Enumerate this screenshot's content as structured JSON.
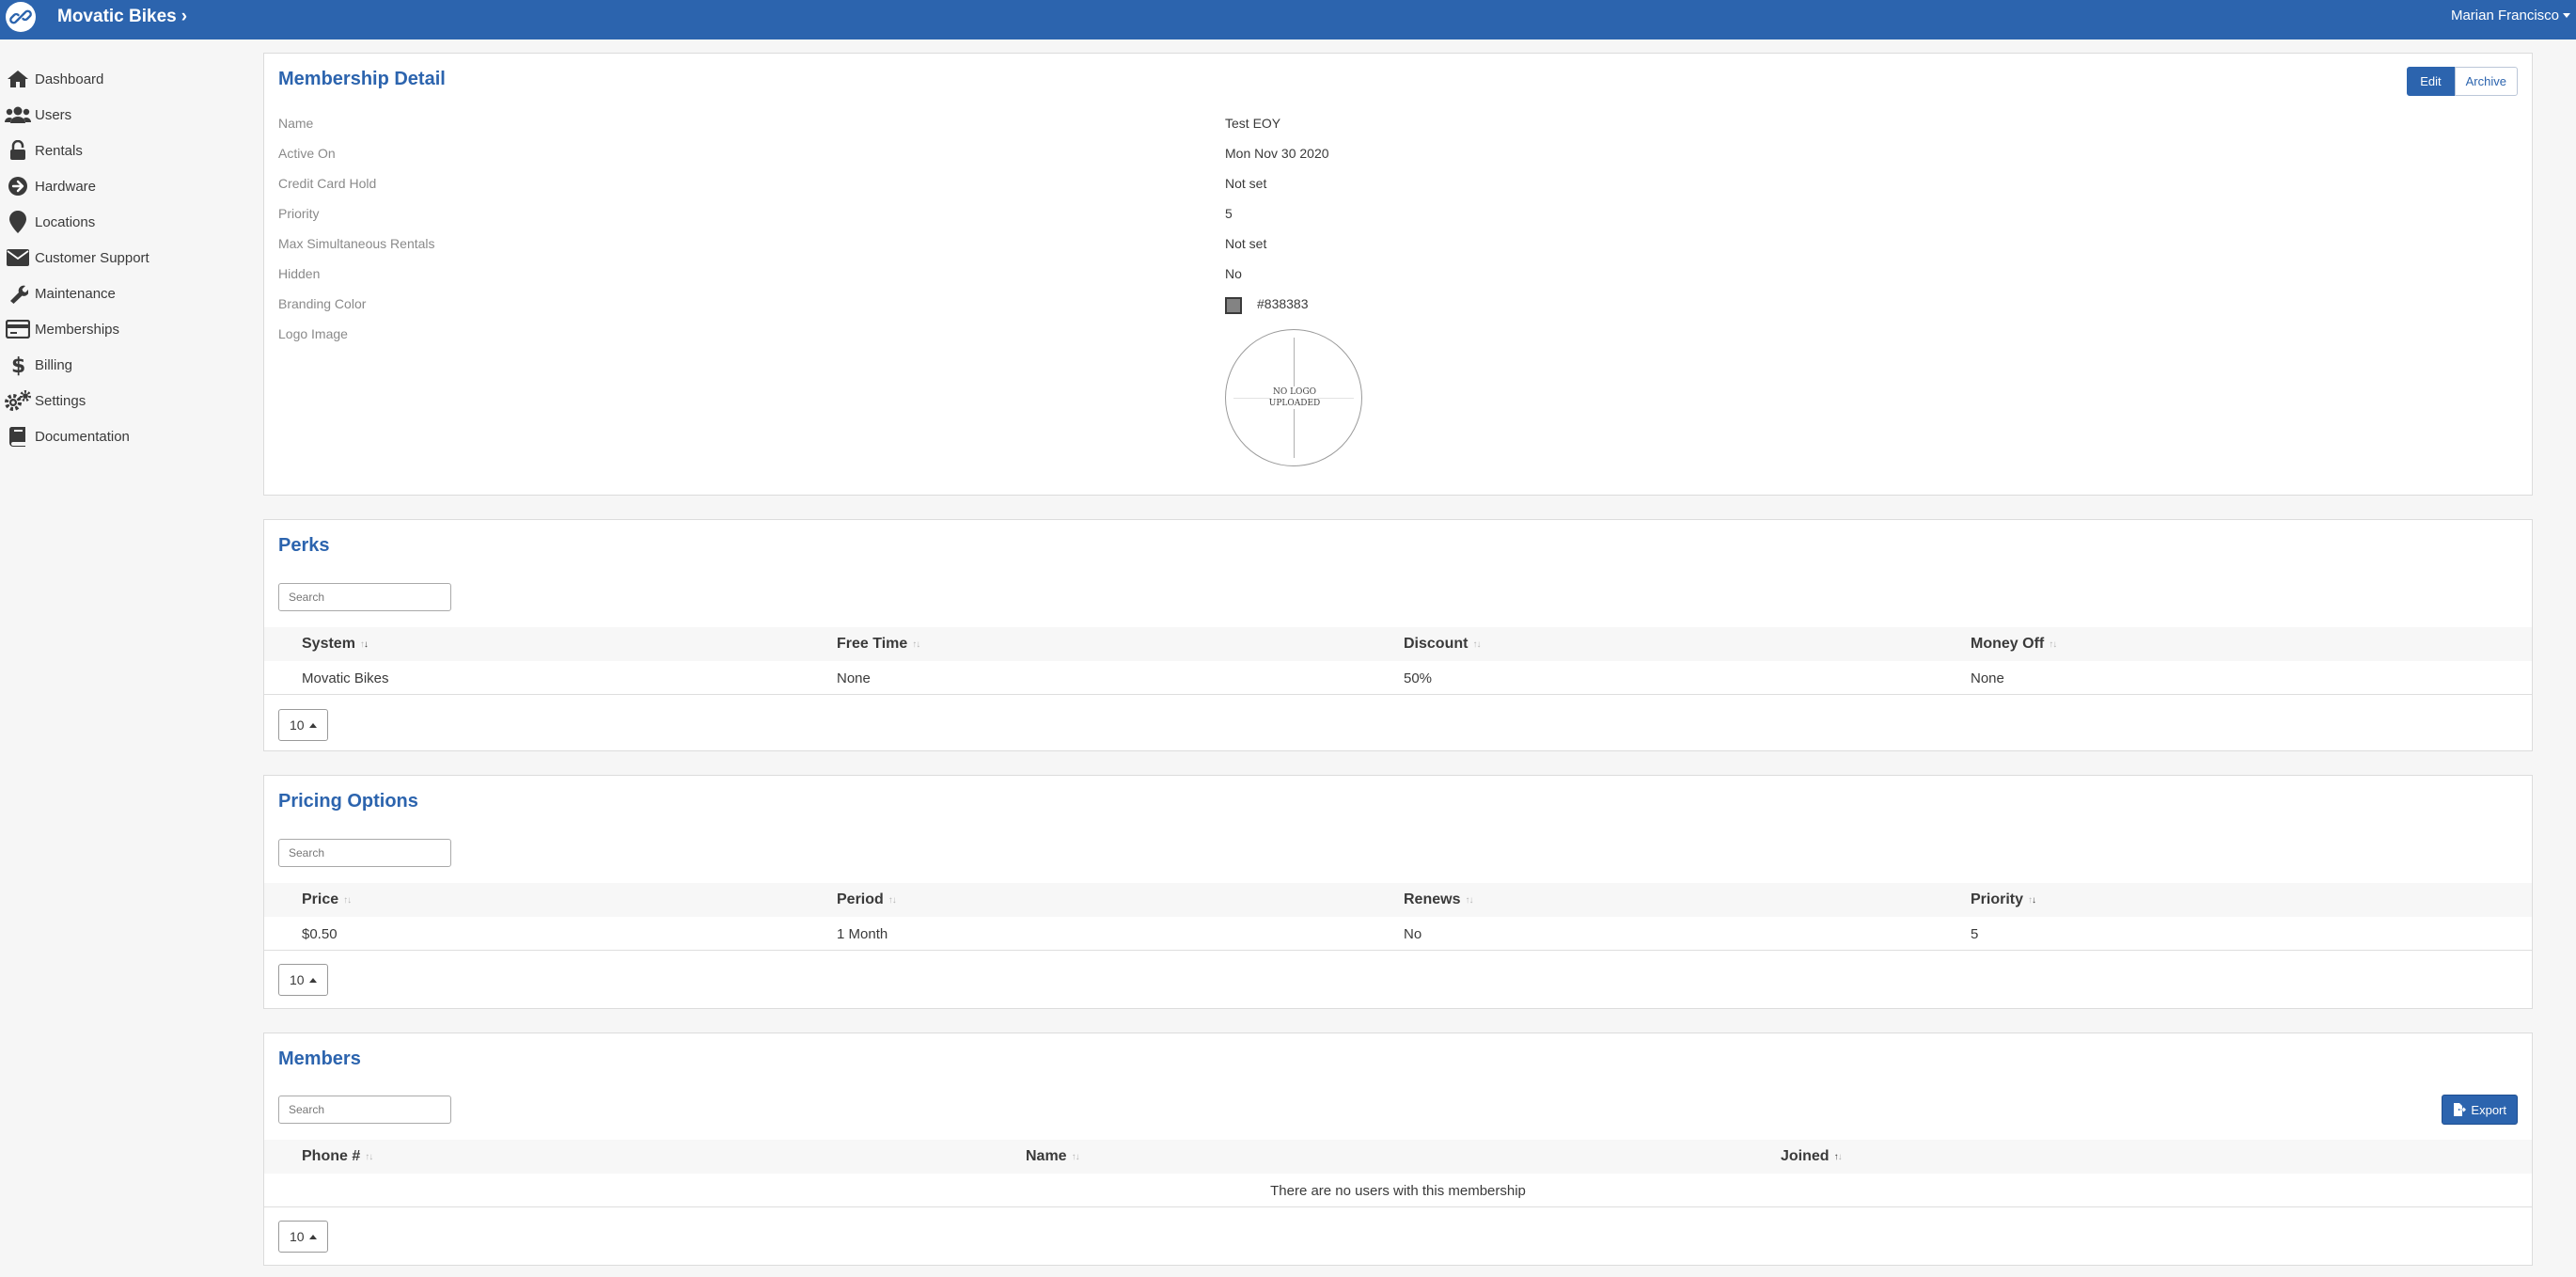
{
  "topbar": {
    "brand": "Movatic Bikes",
    "brand_chevron": "›",
    "user": "Marian Francisco",
    "logo_icon": "chain-link-icon"
  },
  "sidebar": {
    "items": [
      {
        "label": "Dashboard",
        "icon": "home-icon"
      },
      {
        "label": "Users",
        "icon": "users-icon"
      },
      {
        "label": "Rentals",
        "icon": "lock-icon"
      },
      {
        "label": "Hardware",
        "icon": "arrow-circle-icon"
      },
      {
        "label": "Locations",
        "icon": "map-pin-icon"
      },
      {
        "label": "Customer Support",
        "icon": "envelope-icon"
      },
      {
        "label": "Maintenance",
        "icon": "wrench-icon"
      },
      {
        "label": "Memberships",
        "icon": "id-card-icon"
      },
      {
        "label": "Billing",
        "icon": "dollar-icon"
      },
      {
        "label": "Settings",
        "icon": "gears-icon"
      },
      {
        "label": "Documentation",
        "icon": "book-icon"
      }
    ]
  },
  "detail": {
    "title": "Membership Detail",
    "edit_label": "Edit",
    "archive_label": "Archive",
    "fields": [
      {
        "label": "Name",
        "value": "Test EOY"
      },
      {
        "label": "Active On",
        "value": "Mon Nov 30 2020"
      },
      {
        "label": "Credit Card Hold",
        "value": "Not set"
      },
      {
        "label": "Priority",
        "value": "5"
      },
      {
        "label": "Max Simultaneous Rentals",
        "value": "Not set"
      },
      {
        "label": "Hidden",
        "value": "No"
      },
      {
        "label": "Branding Color",
        "value": "#838383"
      },
      {
        "label": "Logo Image",
        "value": ""
      }
    ],
    "branding_color": "#838383",
    "logo_placeholder_line1": "NO LOGO",
    "logo_placeholder_line2": "UPLOADED"
  },
  "perks": {
    "title": "Perks",
    "search_placeholder": "Search",
    "columns": [
      "System",
      "Free Time",
      "Discount",
      "Money Off"
    ],
    "rows": [
      [
        "Movatic Bikes",
        "None",
        "50%",
        "None"
      ]
    ],
    "page_size": "10"
  },
  "pricing": {
    "title": "Pricing Options",
    "search_placeholder": "Search",
    "columns": [
      "Price",
      "Period",
      "Renews",
      "Priority"
    ],
    "rows": [
      [
        "$0.50",
        "1 Month",
        "No",
        "5"
      ]
    ],
    "page_size": "10"
  },
  "members": {
    "title": "Members",
    "search_placeholder": "Search",
    "export_label": "Export",
    "columns": [
      "Phone #",
      "Name",
      "Joined"
    ],
    "empty_text": "There are no users with this membership",
    "page_size": "10"
  },
  "colors": {
    "primary": "#2c64ae",
    "background": "#f6f6f6"
  }
}
